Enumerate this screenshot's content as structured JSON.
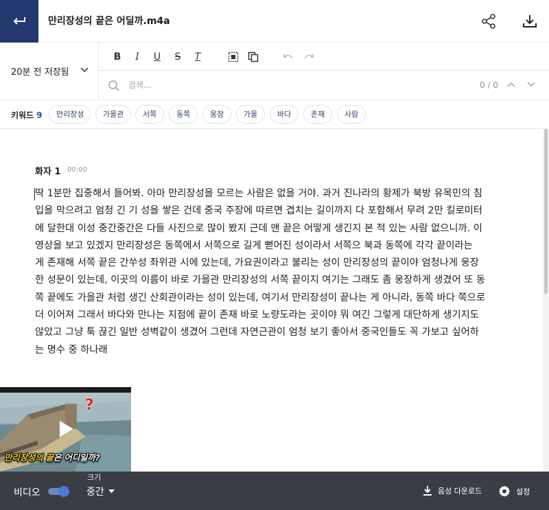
{
  "header": {
    "back_icon": "return-arrow-icon",
    "title": "만리장성의 끝은 어딜까.m4a",
    "share_icon": "share-icon",
    "download_icon": "download-icon"
  },
  "editor": {
    "save_status": "20분 전 저장됨",
    "format_icons": [
      "bold-icon",
      "italic-icon",
      "underline-icon",
      "strikethrough-icon",
      "clear-format-icon",
      "select-all-icon",
      "copy-icon",
      "undo-icon",
      "redo-icon"
    ],
    "format_glyphs": {
      "bold": "B",
      "italic": "I",
      "underline": "U",
      "strike": "S",
      "clear": "T"
    }
  },
  "search": {
    "placeholder": "검색...",
    "count": "0 / 0"
  },
  "keywords": {
    "label": "키워드",
    "count": "9",
    "items": [
      "만리장성",
      "가을관",
      "서쪽",
      "동쪽",
      "웅장",
      "가을",
      "바다",
      "존재",
      "사람"
    ]
  },
  "transcript": {
    "speaker": "화자 1",
    "timestamp": "00:00",
    "text": "딱 1분만 집중해서 들어봐. 아마 만리장성을 모르는 사람은 없을 거야. 과거 진나라의 황제가 북방 유목민의 침\n입을 막으려고 엄청 긴 기 성을 쌓은 건데 중국 주장에 따르면 겹치는 길이까지 다 포함해서 무려 2만 킬로미터\n에 달한대 이성 중간중간은 다들 사진으로 많이 봤지 근데 맨 끝은 어떻게 생긴지 본 적 있는 사람 없으니까. 이\n영상을 보고 있겠지 만리장성은 동쪽에서 서쪽으로 길게 뻗어진 성이라서 서쪽으 북과 동쪽에 각각 끝이라는\n게 존재해 서쪽 끝은 간쑤성 좌위관 시에 있는데, 가요권이라고 불리는 성이 만리장성의 끝이야 엄청나게 웅장\n한 성문이 있는데, 이곳의 이름이 바로 가을관 만리장성의 서쪽 끝이지 여기는 그래도 좀 웅장하게 생겼어 또 동\n쪽 끝에도 가을관 처럼 생긴 산회관이라는 성이 있는데, 여기서 만리장성이 끝나는 게 아니라, 동쪽 바다 쪽으로\n더 이어져 그래서 바다와 만나는 지점에 끝이 존재 바로 노량도라는 곳이야 뭐 여긴 그렇게 대단하게 생기지도\n않았고 그냥 툭 끊긴 일반 성벽같이 생겼어 그런데 자연근관이 엄청 보기 좋아서 중국인들도 꼭 가보고 싶어하\n는 명수 중 하나래"
  },
  "video": {
    "caption_highlight": "만리장성의 끝",
    "caption_rest": "은 어디일까?",
    "badge": "?",
    "play_icon": "play-icon"
  },
  "bottom_bar": {
    "video_label": "비디오",
    "video_on": true,
    "size_label": "크기",
    "size_value": "중간",
    "audio_download": "음성 다운로드",
    "settings": "설정"
  }
}
